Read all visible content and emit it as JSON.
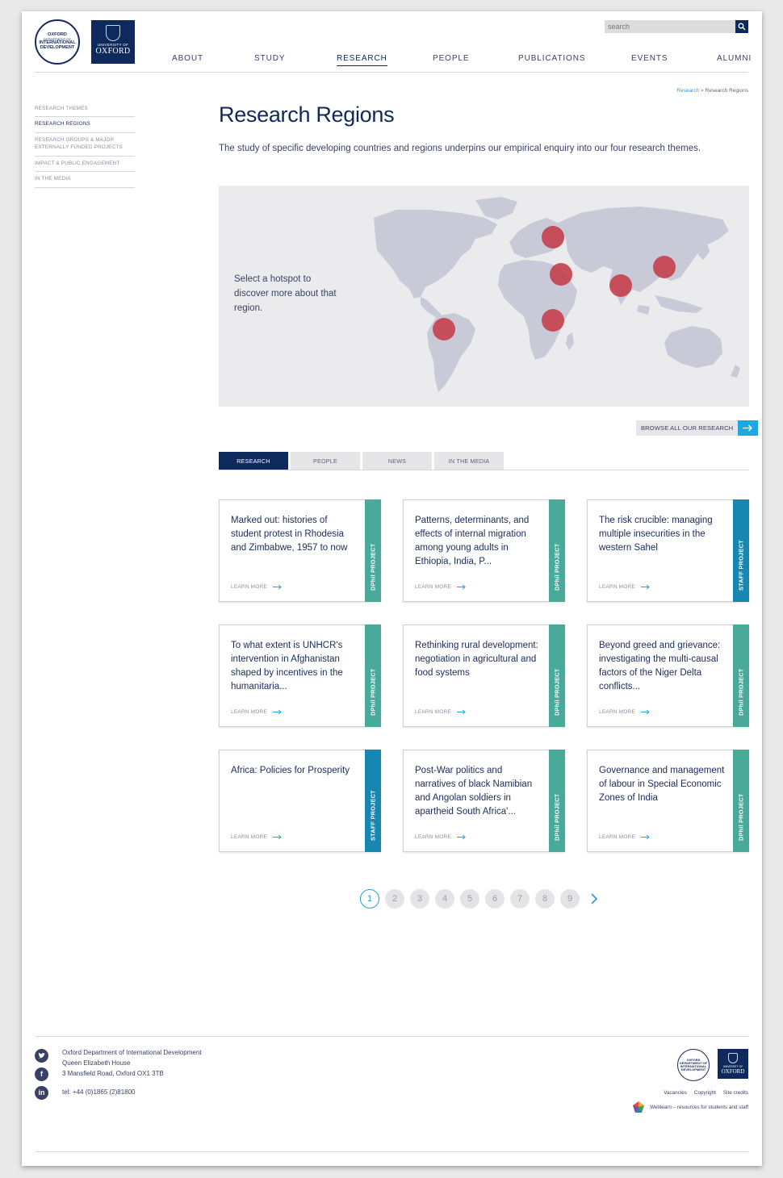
{
  "header": {
    "oid_logo": [
      "OXFORD",
      "DEPARTMENT OF",
      "INTERNATIONAL",
      "DEVELOPMENT"
    ],
    "oxford_logo": {
      "small": "UNIVERSITY OF",
      "big": "OXFORD"
    },
    "search_placeholder": "search",
    "nav": [
      "ABOUT",
      "STUDY",
      "RESEARCH",
      "PEOPLE",
      "PUBLICATIONS",
      "EVENTS",
      "ALUMNI"
    ],
    "active_nav": "RESEARCH"
  },
  "breadcrumb": {
    "link": "Research",
    "sep": ">",
    "current": "Research Regions"
  },
  "sidebar": {
    "items": [
      "RESEARCH THEMES",
      "RESEARCH REGIONS",
      "RESEARCH GROUPS & MAJOR EXTERNALLY FUNDED PROJECTS",
      "IMPACT & PUBLIC ENGAGEMENT",
      "IN THE MEDIA"
    ],
    "active": "RESEARCH REGIONS"
  },
  "main": {
    "title": "Research Regions",
    "intro": "The study of specific developing countries and regions underpins our empirical enquiry into our four research themes.",
    "map_prompt": "Select a hotspot to discover more about that region.",
    "browse_label": "BROWSE ALL OUR RESEARCH",
    "tabs": [
      "RESEARCH",
      "PEOPLE",
      "NEWS",
      "IN THE MEDIA"
    ],
    "active_tab": "RESEARCH"
  },
  "cards": [
    {
      "title": "Marked out: histories of student protest in Rhodesia and Zimbabwe, 1957 to now",
      "more": "LEARN MORE",
      "tag": "DPhil PROJECT",
      "type": "dphil"
    },
    {
      "title": "Patterns, determinants, and effects of internal migration among young adults in Ethiopia, India, P...",
      "more": "LEARN MORE",
      "tag": "DPhil PROJECT",
      "type": "dphil"
    },
    {
      "title": "The risk crucible: managing multiple insecurities in the western Sahel",
      "more": "LEARN MORE",
      "tag": "STAFF PROJECT",
      "type": "staff"
    },
    {
      "title": "To what extent is UNHCR's intervention in Afghanistan shaped by incentives in the humanitaria...",
      "more": "LEARN MORE",
      "tag": "DPhil PROJECT",
      "type": "dphil"
    },
    {
      "title": "Rethinking rural development: negotiation in agricultural and food systems",
      "more": "LEARN MORE",
      "tag": "DPhil PROJECT",
      "type": "dphil"
    },
    {
      "title": "Beyond greed and grievance: investigating the multi-causal factors of the Niger Delta conflicts...",
      "more": "LEARN MORE",
      "tag": "DPhil PROJECT",
      "type": "dphil"
    },
    {
      "title": "Africa: Policies for Prosperity",
      "more": "LEARN MORE",
      "tag": "STAFF PROJECT",
      "type": "staff"
    },
    {
      "title": "Post-War politics and narratives of black Namibian and Angolan soldiers in apartheid South Africa'...",
      "more": "LEARN MORE",
      "tag": "DPhil PROJECT",
      "type": "dphil"
    },
    {
      "title": "Governance and management of labour in Special Economic Zones of India",
      "more": "LEARN MORE",
      "tag": "DPhil PROJECT",
      "type": "dphil"
    }
  ],
  "pagination": {
    "pages": [
      "1",
      "2",
      "3",
      "4",
      "5",
      "6",
      "7",
      "8",
      "9"
    ],
    "current": "1"
  },
  "footer": {
    "address": [
      "Oxford Department of International Development",
      "Queen Elizabeth House",
      "3 Mansfield Road, Oxford OX1 3TB"
    ],
    "tel": "tel: +44 (0)1865 (2)81800",
    "social": [
      "twitter-icon",
      "facebook-icon",
      "linkedin-icon"
    ],
    "links": [
      "Vacancies",
      "Copyright",
      "Site credits"
    ],
    "weblearn": "Weblearn – resources for students and staff"
  },
  "colors": {
    "navy": "#0e2a5c",
    "accent": "#1ea7e1",
    "dphil": "#4aaa9a",
    "staff": "#1787b2",
    "hotspot": "#c4434f"
  }
}
